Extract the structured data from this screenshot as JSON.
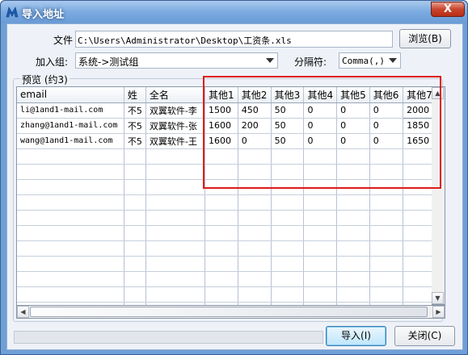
{
  "window": {
    "title": "导入地址",
    "close_label": "X"
  },
  "file": {
    "label": "文件",
    "path": "C:\\Users\\Administrator\\Desktop\\工资条.xls",
    "browse_label": "浏览(B)"
  },
  "group": {
    "label": "加入组:",
    "value": "系统->测试组"
  },
  "separator": {
    "label": "分隔符:",
    "value": "Comma(,)"
  },
  "preview": {
    "title": "预览 (约3)",
    "columns": [
      "email",
      "姓",
      "全名",
      "其他1",
      "其他2",
      "其他3",
      "其他4",
      "其他5",
      "其他6",
      "其他7"
    ],
    "rows": [
      [
        "li@1and1-mail.com",
        "不5",
        "双翼软件-李",
        "1500",
        "450",
        "50",
        "0",
        "0",
        "0",
        "2000"
      ],
      [
        "zhang@1and1-mail.com",
        "不5",
        "双翼软件-张",
        "1600",
        "200",
        "50",
        "0",
        "0",
        "0",
        "1850"
      ],
      [
        "wang@1and1-mail.com",
        "不5",
        "双翼软件-王",
        "1600",
        "0",
        "50",
        "0",
        "0",
        "0",
        "1650"
      ]
    ],
    "empty_rows": 11
  },
  "progress": {
    "value": 0
  },
  "buttons": {
    "import_label": "导入(I)",
    "close_label": "关闭(C)"
  },
  "colors": {
    "highlight": "#e01a1a",
    "title_bar": "#7aaae0"
  },
  "icons": {
    "app": "app-logo-icon",
    "close": "close-icon",
    "dropdown": "chevron-down-icon"
  }
}
